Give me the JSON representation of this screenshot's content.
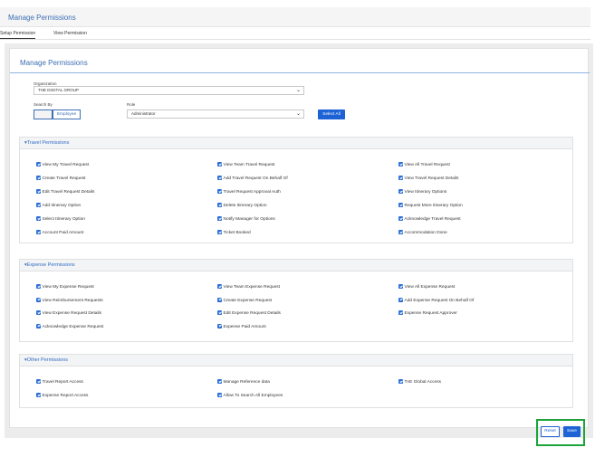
{
  "header": {
    "title": "Manage Permissions"
  },
  "tabs": [
    {
      "label": "Setup Permission"
    },
    {
      "label": "View Permission"
    }
  ],
  "card": {
    "title": "Manage Permissions"
  },
  "form": {
    "organization_label": "Organization",
    "organization_value": "THE DIGITAL GROUP",
    "search_by_label": "Search By",
    "search_by_options": [
      "",
      "Employee"
    ],
    "role_label": "Role",
    "role_value": "Administrator",
    "select_all_label": "Select All"
  },
  "sections": [
    {
      "title": "Travel Permissions",
      "columns": [
        [
          "View My Travel Request",
          "Create Travel Request",
          "Edit Travel Request Details",
          "Add Itinerary Option",
          "Select Itinerary Option",
          "Account Paid Amount"
        ],
        [
          "View Team Travel Request",
          "Add Travel Request On Behalf Of",
          "Travel Request Approval Auth",
          "Delete Itinerary Option",
          "Notify Manager for Options",
          "Ticket Booked"
        ],
        [
          "View All Travel Request",
          "View Travel Request Details",
          "View Itinerary Options",
          "Request More Itinerary Option",
          "Acknowledge Travel Request",
          "Accommodation Done"
        ]
      ]
    },
    {
      "title": "Expense Permissions",
      "columns": [
        [
          "View My Expense Request",
          "View Reimbursement Requests",
          "View Expense Request Details",
          "Acknowledge Expense Request"
        ],
        [
          "View Team Expense Request",
          "Create Expense Request",
          "Edit Expense Request Details",
          "Expense Paid Amount"
        ],
        [
          "View All Expense Request",
          "Add Expense Request On Behalf Of",
          "Expense Request Approver"
        ]
      ]
    },
    {
      "title": "Other Permissions",
      "columns": [
        [
          "Travel Report Access",
          "Expense Report Access"
        ],
        [
          "Manage Reference data",
          "Allow To Search All Employees"
        ],
        [
          "TnE Global Access"
        ]
      ]
    }
  ],
  "actions": {
    "reset_label": "Reset",
    "save_label": "Save"
  }
}
